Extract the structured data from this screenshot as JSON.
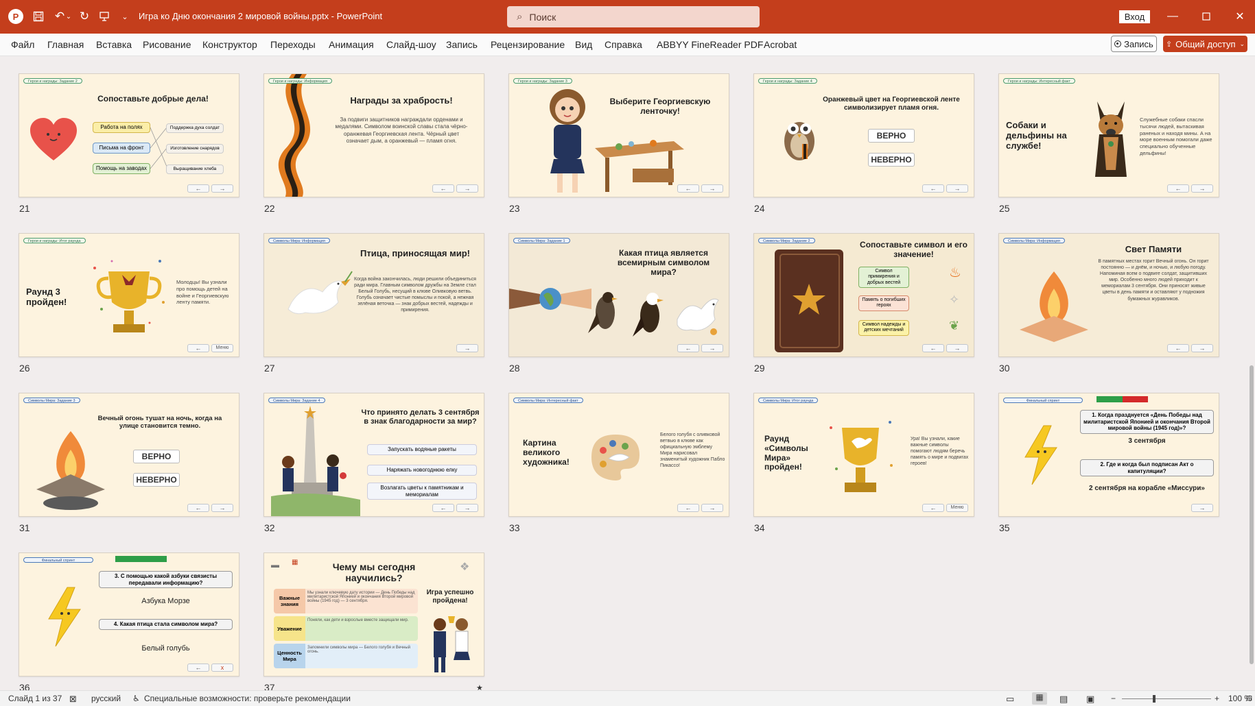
{
  "titlebar": {
    "doc_title": "Игра ко Дню окончания 2 мировой войны.pptx  -  PowerPoint",
    "search_placeholder": "Поиск",
    "signin": "Вход"
  },
  "ribbon": {
    "tabs": [
      "Файл",
      "Главная",
      "Вставка",
      "Рисование",
      "Конструктор",
      "Переходы",
      "Анимация",
      "Слайд-шоу",
      "Запись",
      "Рецензирование",
      "Вид",
      "Справка",
      "ABBYY FineReader PDF",
      "Acrobat"
    ],
    "record": "Запись",
    "share": "Общий доступ"
  },
  "slides": [
    {
      "num": "21",
      "tag": "Герои и награды: Задание 2",
      "title": "Сопоставьте добрые дела!",
      "left": [
        "Работа на полях",
        "Письма на фронт",
        "Помощь на заводах"
      ],
      "right": [
        "Поддержка духа солдат",
        "Изготовление снарядов",
        "Выращивание хлеба"
      ]
    },
    {
      "num": "22",
      "tag": "Герои и награды: Информация",
      "title": "Награды за храбрость!",
      "body": "За подвиги защитников награждали орденами и медалями. Символом воинской славы стала чёрно-оранжевая Георгиевская лента. Чёрный цвет означает дым, а оранжевый — пламя огня."
    },
    {
      "num": "23",
      "tag": "Герои и награды: Задание 3",
      "title": "Выберите Георгиевскую ленточку!"
    },
    {
      "num": "24",
      "tag": "Герои и награды: Задание 4",
      "title": "Оранжевый цвет на Георгиевской ленте символизирует пламя огня.",
      "opt1": "ВЕРНО",
      "opt2": "НЕВЕРНО"
    },
    {
      "num": "25",
      "tag": "Герои и награды: Интересный факт",
      "title": "Собаки и дельфины на службе!",
      "body": "Служебные собаки спасли тысячи людей, вытаскивая раненых и находя мины. А на море военным помогали даже специально обученные дельфины!"
    },
    {
      "num": "26",
      "tag": "Герои и награды: Итог раунда",
      "title": "Раунд 3 пройден!",
      "body": "Молодцы! Вы узнали про помощь детей на войне и Георгиевскую ленту памяти.",
      "menu": "Меню"
    },
    {
      "num": "27",
      "tag": "Символы Мира: Информация",
      "title": "Птица, приносящая мир!",
      "body": "Когда война закончилась, люди решили объединиться ради мира. Главным символом дружбы на Земле стал Белый Голубь, несущий в клюве Оливковую ветвь. Голубь означает чистые помыслы и покой, а нежная зелёная веточка — знак добрых вестей, надежды и примирения."
    },
    {
      "num": "28",
      "tag": "Символы Мира: Задание 1",
      "title": "Какая птица является всемирным символом мира?"
    },
    {
      "num": "29",
      "tag": "Символы Мира: Задание 2",
      "title": "Сопоставьте символ и его значение!",
      "items": [
        "Символ примирения и добрых вестей",
        "Память о погибших героях",
        "Символ надежды и детских мечтаний"
      ]
    },
    {
      "num": "30",
      "tag": "Символы Мира: Информация",
      "title": "Свет Памяти",
      "body": "В памятных местах горит Вечный огонь. Он горит постоянно — и днём, и ночью, и любую погоду. Напоминая всем о подвиге солдат, защитивших мир. Особенно много людей приходит к мемориалам 3 сентября. Они приносят живые цветы в день памяти и оставляют у подножия бумажных журавликов."
    },
    {
      "num": "31",
      "tag": "Символы Мира: Задание 3",
      "title": "Вечный огонь тушат на ночь, когда на улице становится темно.",
      "opt1": "ВЕРНО",
      "opt2": "НЕВЕРНО"
    },
    {
      "num": "32",
      "tag": "Символы Мира: Задание 4",
      "title": "Что принято делать 3 сентября в знак благодарности за мир?",
      "items": [
        "Запускать водяные ракеты",
        "Наряжать новогоднюю елку",
        "Возлагать цветы к памятникам и мемориалам"
      ]
    },
    {
      "num": "33",
      "tag": "Символы Мира: Интересный факт",
      "title": "Картина великого художника!",
      "body": "Белого голубя с оливковой ветвью в клюве как официальную эмблему Мира нарисовал знаменитый художник Пабло Пикассо!"
    },
    {
      "num": "34",
      "tag": "Символы Мира: Итог раунда",
      "title": "Раунд «Символы Мира» пройден!",
      "body": "Ура! Вы узнали, какие важные символы помогают людям беречь память о мире и подвигах героев!",
      "menu": "Меню"
    },
    {
      "num": "35",
      "tag": "Финальный спринт",
      "q1": "1. Когда празднуется «День Победы над милитаристской Японией и окончания Второй мировой войны (1945 год)»?",
      "a1": "3 сентября",
      "q2": "2. Где и когда был подписан Акт о капитуляции?",
      "a2": "2 сентября на корабле «Миссури»"
    },
    {
      "num": "36",
      "tag": "Финальный спринт",
      "q1": "3. С помощью какой азбуки связисты передавали информацию?",
      "a1": "Азбука Морзе",
      "q2": "4. Какая птица стала символом мира?",
      "a2": "Белый голубь"
    },
    {
      "num": "37",
      "title": "Чему мы сегодня научились?",
      "rows": [
        {
          "label": "Важные знания",
          "text": "Мы узнали ключевую дату истории — День Победы над милитаристской Японией и окончания Второй мировой войны (1945 год) — 3 сентября."
        },
        {
          "label": "Уважение",
          "text": "Поняли, как дети и взрослые вместе защищали мир."
        },
        {
          "label": "Ценность Мира",
          "text": "Запомнили символы мира — Белого голубя и Вечный огонь."
        }
      ],
      "done": "Игра успешно пройдена!"
    }
  ],
  "nav": {
    "prev": "←",
    "next": "→",
    "close": "x"
  },
  "statusbar": {
    "slide_info": "Слайд 1 из 37",
    "language": "русский",
    "accessibility": "Специальные возможности: проверьте рекомендации",
    "zoom": "100 %"
  }
}
